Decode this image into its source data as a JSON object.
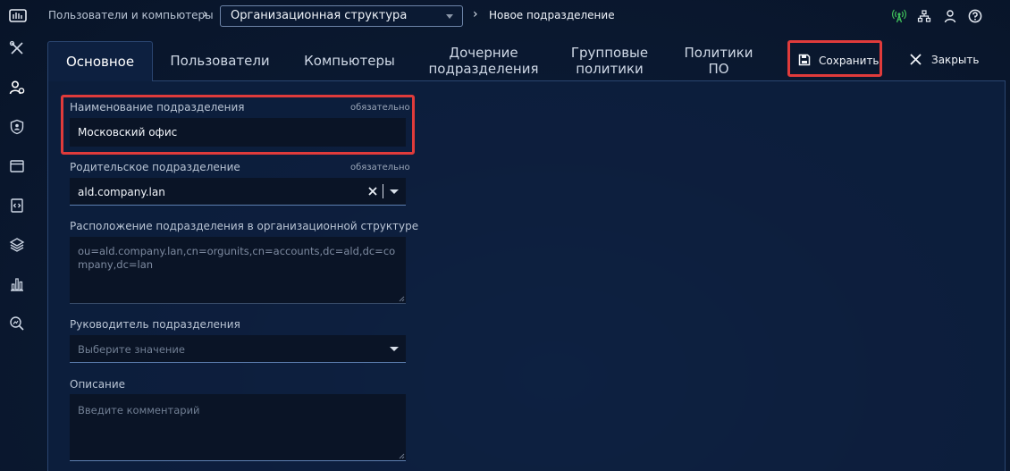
{
  "breadcrumb": {
    "root": "Пользователи и компьютеры",
    "section_selected": "Организационная структура",
    "current": "Новое подразделение"
  },
  "top_icons": [
    "antenna-icon",
    "org-tree-icon",
    "user-icon",
    "help-icon"
  ],
  "sidebar": [
    "tools-icon",
    "users-icon",
    "shield-user-icon",
    "browser-window-icon",
    "code-file-icon",
    "layers-icon",
    "bar-chart-icon",
    "search-chart-icon"
  ],
  "tabs": [
    {
      "label": "Основное",
      "active": true
    },
    {
      "label": "Пользователи"
    },
    {
      "label": "Компьютеры"
    },
    {
      "label": "Дочерние подразделения"
    },
    {
      "label": "Групповые политики"
    },
    {
      "label": "Политики ПО"
    }
  ],
  "actions": {
    "save_label": "Сохранить",
    "close_label": "Закрыть"
  },
  "form": {
    "name": {
      "label": "Наименование подразделения",
      "required": "обязательно",
      "value": "Московский офис"
    },
    "parent": {
      "label": "Родительское подразделение",
      "required": "обязательно",
      "value": "ald.company.lan"
    },
    "location": {
      "label": "Расположение подразделения в организационной структуре",
      "value": "ou=ald.company.lan,cn=orgunits,cn=accounts,dc=ald,dc=company,dc=lan"
    },
    "manager": {
      "label": "Руководитель подразделения",
      "placeholder": "Выберите значение"
    },
    "description": {
      "label": "Описание",
      "placeholder": "Введите комментарий"
    }
  },
  "colors": {
    "accent_highlight": "#e03b3b",
    "antenna_active": "#3fbf5a",
    "background": "#0b1a33"
  }
}
